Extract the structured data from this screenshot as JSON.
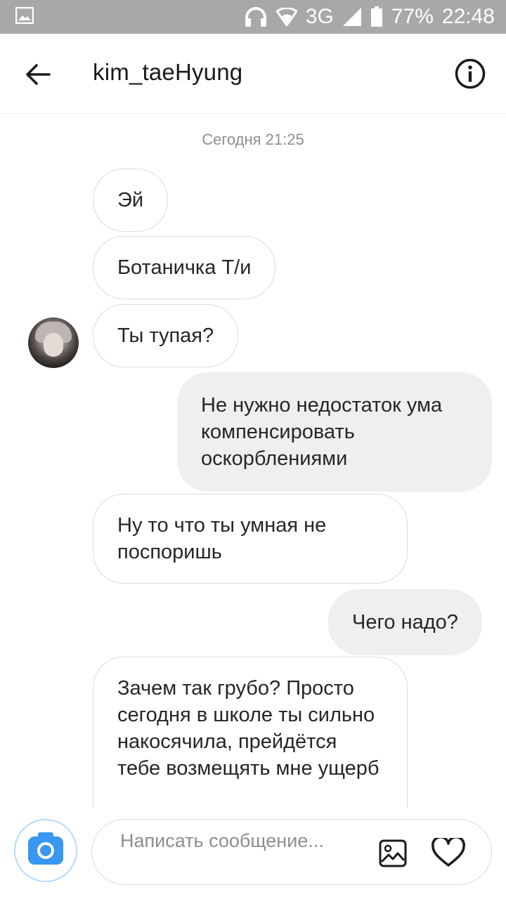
{
  "status_bar": {
    "network": "3G",
    "battery": "77%",
    "time": "22:48"
  },
  "header": {
    "username": "kim_taeHyung",
    "back_icon": "arrow-left-icon",
    "info_icon": "info-icon"
  },
  "chat": {
    "timestamp": "Сегодня 21:25",
    "messages": [
      {
        "direction": "in",
        "text": "Эй"
      },
      {
        "direction": "in",
        "text": "Ботаничка Т/и"
      },
      {
        "direction": "in",
        "text": "Ты тупая?"
      },
      {
        "direction": "out",
        "text": "Не нужно недостаток ума компенсировать оскорблениями"
      },
      {
        "direction": "in",
        "text": "Ну то что ты умная не поспоришь"
      },
      {
        "direction": "out",
        "text": "Чего надо?"
      },
      {
        "direction": "in",
        "text": "Зачем так грубо? Просто сегодня в школе ты сильно накосячила, прейдётся тебе возмещять мне ущерб"
      }
    ]
  },
  "composer": {
    "placeholder": "Написать сообщение...",
    "camera_icon": "camera-icon",
    "gallery_icon": "image-icon",
    "like_icon": "heart-icon"
  },
  "colors": {
    "status_bar": "#a8a8a8",
    "incoming_border": "#dbdbdb",
    "outgoing_bg": "#efefef",
    "camera_blue": "#3897f0",
    "timestamp": "#8e8e8e"
  }
}
